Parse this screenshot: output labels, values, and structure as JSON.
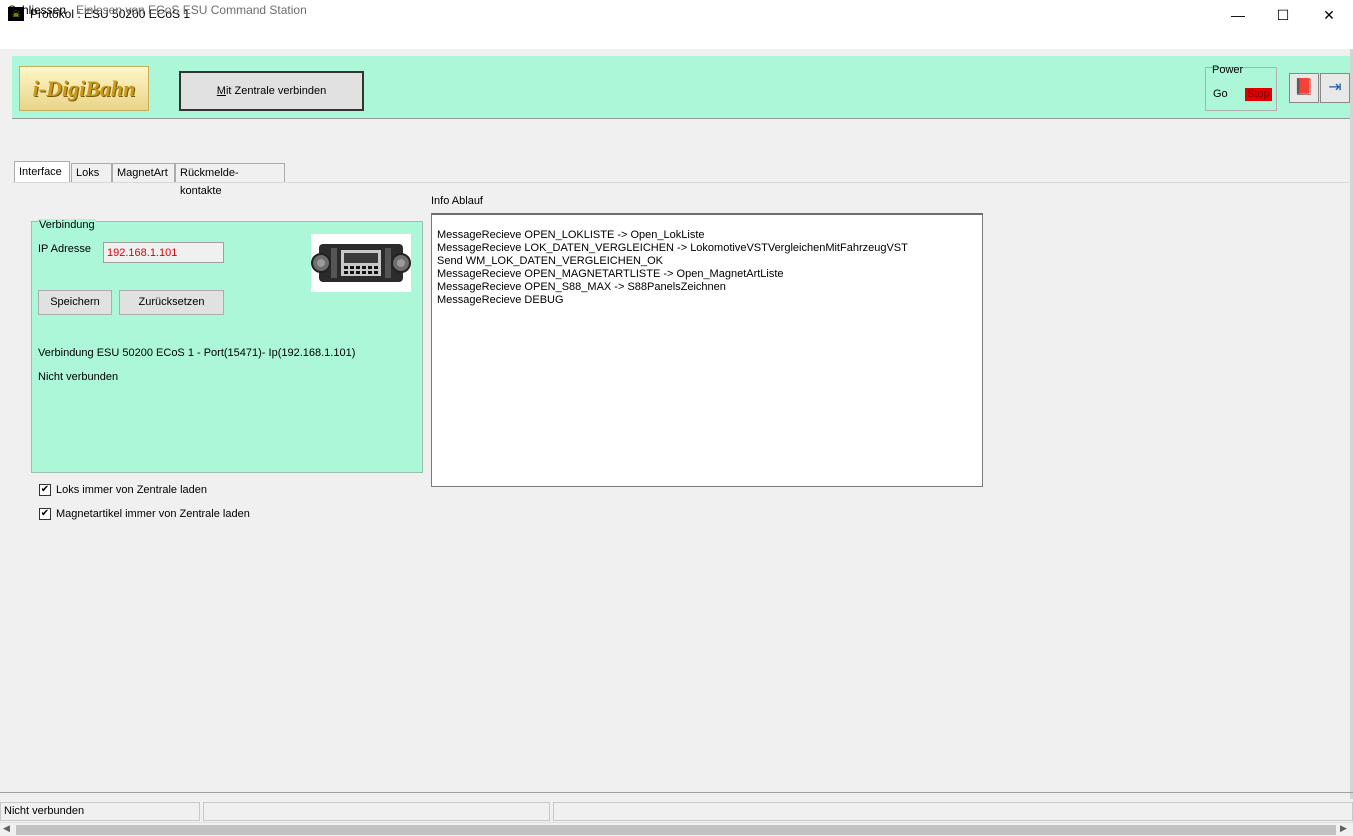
{
  "window": {
    "title": "Protokol : ESU 50200 ECoS 1",
    "app_icon": "digibahn-icon",
    "minimize": "—",
    "maximize": "☐",
    "close": "✕"
  },
  "menu": {
    "close_label": "Schliessen",
    "info_label": "Einlesen von ECoS ESU Command Station"
  },
  "toolbar": {
    "logo_text": "i-DigiBahn",
    "connect_label_prefix": "M",
    "connect_label_rest": "it Zentrale verbinden",
    "power_label": "Power",
    "go_label": "Go",
    "stop_label": "Stop",
    "stop_color": "#e00000",
    "book_icon": "book-icon",
    "exit_icon": "exit-icon",
    "background_color": "#adf7d9"
  },
  "tabs": [
    {
      "label": "Interface",
      "active": true
    },
    {
      "label": "Loks",
      "active": false
    },
    {
      "label": "MagnetArt",
      "active": false
    },
    {
      "label": "Rückmelde-kontakte",
      "active": false
    }
  ],
  "verbindung": {
    "group_title": "Verbindung",
    "ip_label": "IP Adresse",
    "ip_value": "192.168.1.101",
    "save_label": "Speichern",
    "reset_label": "Zurücksetzen",
    "connection_info": "Verbindung ESU 50200 ECoS 1 - Port(15471)- Ip(192.168.1.101)",
    "connection_status": "Nicht verbunden"
  },
  "options": {
    "load_locos": {
      "label": "Loks immer von Zentrale laden",
      "checked": true
    },
    "load_magnets": {
      "label": "Magnetartikel immer von Zentrale laden",
      "checked": true
    }
  },
  "info": {
    "label": "Info Ablauf",
    "lines": [
      "MessageRecieve OPEN_LOKLISTE -> Open_LokListe",
      "MessageRecieve LOK_DATEN_VERGLEICHEN -> LokomotiveVSTVergleichenMitFahrzeugVST",
      "Send WM_LOK_DATEN_VERGLEICHEN_OK",
      "MessageRecieve OPEN_MAGNETARTLISTE -> Open_MagnetArtListe",
      "MessageRecieve OPEN_S88_MAX -> S88PanelsZeichnen",
      "MessageRecieve DEBUG"
    ]
  },
  "statusbar": {
    "cell1": "Nicht verbunden",
    "cell2": "",
    "cell3": ""
  }
}
